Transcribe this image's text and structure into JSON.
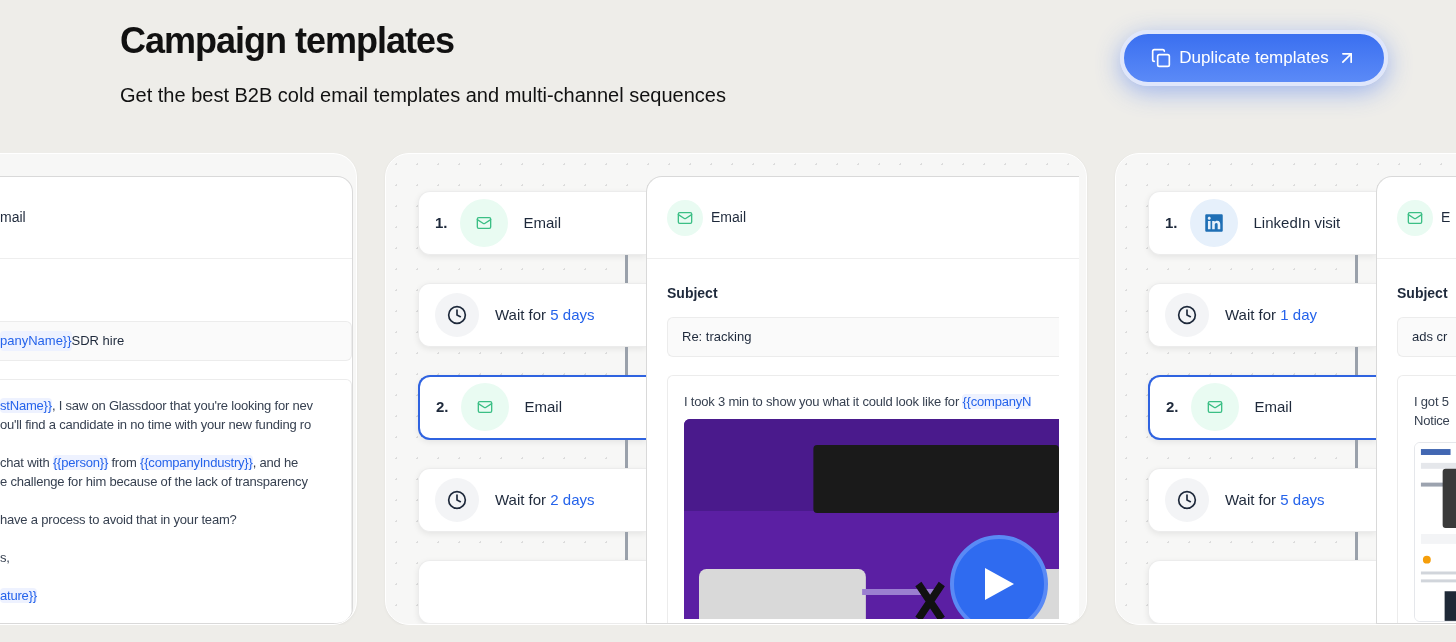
{
  "header": {
    "title": "Campaign templates",
    "subtitle": "Get the best B2B cold email templates and multi-channel sequences",
    "button": {
      "label": "Duplicate templates"
    }
  },
  "cards": [
    {
      "kind": "email_only",
      "email": {
        "channel_label": "mail",
        "subject": [
          {
            "text": "panyName}}",
            "variable": true
          },
          {
            "text": " SDR hire",
            "variable": false
          }
        ],
        "body": [
          [
            [
              {
                "text": "stName}}",
                "variable": true
              },
              {
                "text": ", I saw on Glassdoor that you're looking for nev",
                "variable": false
              }
            ],
            [
              {
                "text": "ou'll find a candidate in no time with your new funding ro",
                "variable": false
              }
            ]
          ],
          [
            [
              {
                "text": " chat with ",
                "variable": false
              },
              {
                "text": "{{person}}",
                "variable": true
              },
              {
                "text": " from ",
                "variable": false
              },
              {
                "text": "{{companyIndustry}}",
                "variable": true
              },
              {
                "text": ", and he",
                "variable": false
              }
            ],
            [
              {
                "text": "e challenge for him because of the lack of transparency",
                "variable": false
              }
            ]
          ],
          [
            [
              {
                "text": " have a process to avoid that in your team?",
                "variable": false
              }
            ]
          ],
          [
            [
              {
                "text": "s,",
                "variable": false
              }
            ]
          ],
          [
            [
              {
                "text": "ature}}",
                "variable": true
              }
            ]
          ]
        ]
      }
    },
    {
      "kind": "sequence",
      "steps": [
        {
          "kind": "action",
          "number": "1.",
          "icon": {
            "kind": "mail"
          },
          "label": "Email",
          "selected": false
        },
        {
          "kind": "wait",
          "prefix": "Wait for",
          "duration": "5 days",
          "selected": false
        },
        {
          "kind": "action",
          "number": "2.",
          "icon": {
            "kind": "mail"
          },
          "label": "Email",
          "selected": true
        },
        {
          "kind": "wait",
          "prefix": "Wait for",
          "duration": "2 days",
          "selected": false
        },
        {
          "kind": "blank",
          "selected": false
        }
      ],
      "email": {
        "icon": {
          "kind": "mail"
        },
        "channel_label": "Email",
        "subject_label": "Subject",
        "subject": [
          {
            "text": "Re: tracking",
            "variable": false
          }
        ],
        "body": [
          [
            [
              {
                "text": "I took 3 min to show you what it could look like for ",
                "variable": false
              },
              {
                "text": "{{companyN",
                "variable": true
              }
            ]
          ]
        ],
        "media": {
          "kind": "video"
        }
      }
    },
    {
      "kind": "sequence",
      "steps": [
        {
          "kind": "action",
          "number": "1.",
          "icon": {
            "kind": "linkedin"
          },
          "label": "LinkedIn visit",
          "selected": false
        },
        {
          "kind": "wait",
          "prefix": "Wait for",
          "duration": "1 day",
          "selected": false
        },
        {
          "kind": "action",
          "number": "2.",
          "icon": {
            "kind": "mail"
          },
          "label": "Email",
          "selected": true
        },
        {
          "kind": "wait",
          "prefix": "Wait for",
          "duration": "5 days",
          "selected": false
        },
        {
          "kind": "blank",
          "selected": false
        }
      ],
      "email": {
        "icon": {
          "kind": "mail"
        },
        "channel_label": "E",
        "subject_label": "Subject",
        "subject": [
          {
            "text": "ads cr",
            "variable": false
          }
        ],
        "body": [
          [
            [
              {
                "text": "I got 5",
                "variable": false
              }
            ],
            [
              {
                "text": "Notice",
                "variable": false
              }
            ]
          ]
        ],
        "media": {
          "kind": "screenshot"
        }
      }
    }
  ]
}
